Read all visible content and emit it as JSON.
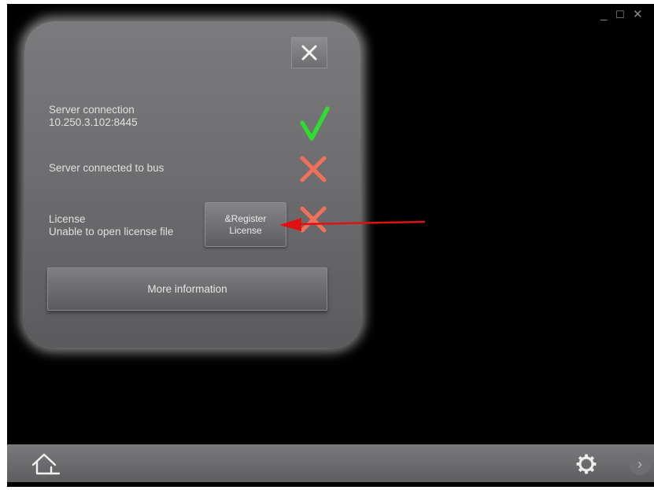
{
  "window": {
    "minimize_glyph": "_",
    "maximize_glyph": "☐",
    "close_glyph": "✕"
  },
  "dialog": {
    "close_icon": "close-icon",
    "rows": [
      {
        "title": "Server connection",
        "detail": "10.250.3.102:8445",
        "status": "ok"
      },
      {
        "title": "Server connected to bus",
        "status": "error"
      },
      {
        "title": "License",
        "detail": "Unable to open license file",
        "status": "error"
      }
    ],
    "register_button": {
      "line1": "&Register",
      "line2": "License"
    },
    "more_info_label": "More information"
  },
  "bottombar": {
    "home_icon": "home-icon",
    "settings_icon": "gear-icon",
    "next_glyph": "›"
  },
  "colors": {
    "ok": "#2fdc2f",
    "error": "#f0705a",
    "annotation_arrow": "#e01010"
  }
}
